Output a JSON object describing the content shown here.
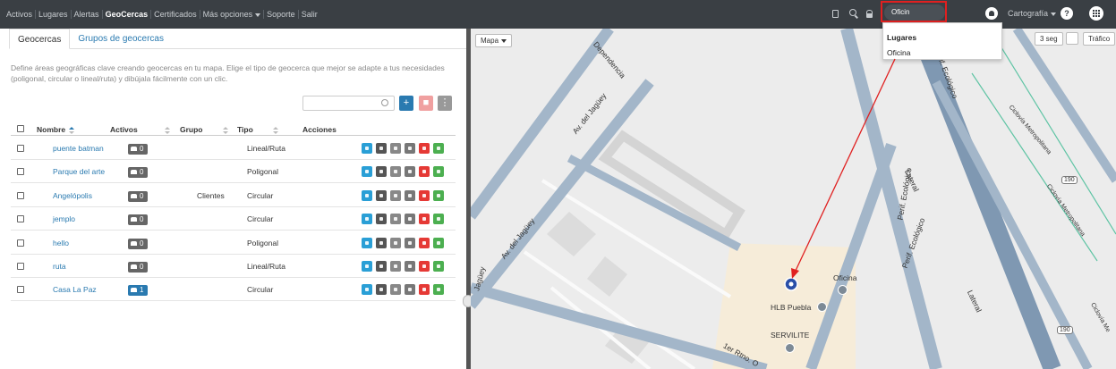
{
  "nav": {
    "items": [
      "Activos",
      "Lugares",
      "Alertas",
      "GeoCercas",
      "Certificados",
      "Más opciones",
      "Soporte",
      "Salir"
    ],
    "active": "GeoCercas"
  },
  "topbar": {
    "search_value": "Oficin",
    "cartography_label": "Cartografía",
    "help_label": "?"
  },
  "dropdown": {
    "header": "Lugares",
    "item": "Oficina"
  },
  "tabs": [
    "Geocercas",
    "Grupos de geocercas"
  ],
  "description": "Define áreas geográficas clave creando geocercas en tu mapa. Elige el tipo de geocerca que mejor se adapte a tus necesidades (poligonal, circular o lineal/ruta) y dibújala fácilmente con un clic.",
  "toolbar": {
    "search_placeholder": "",
    "add_label": "+",
    "delete_label": "■",
    "more_label": "⋮"
  },
  "table": {
    "headers": {
      "name": "Nombre",
      "assets": "Activos",
      "group": "Grupo",
      "type": "Tipo",
      "actions": "Acciones"
    },
    "rows": [
      {
        "name": "puente batman",
        "assets": "0",
        "group": "",
        "type": "Lineal/Ruta",
        "highlight": false
      },
      {
        "name": "Parque del arte",
        "assets": "0",
        "group": "",
        "type": "Poligonal",
        "highlight": false
      },
      {
        "name": "Angelópolis",
        "assets": "0",
        "group": "Clientes",
        "type": "Circular",
        "highlight": false
      },
      {
        "name": "jemplo",
        "assets": "0",
        "group": "",
        "type": "Circular",
        "highlight": false
      },
      {
        "name": "hello",
        "assets": "0",
        "group": "",
        "type": "Poligonal",
        "highlight": false
      },
      {
        "name": "ruta",
        "assets": "0",
        "group": "",
        "type": "Lineal/Ruta",
        "highlight": false
      },
      {
        "name": "Casa La Paz",
        "assets": "1",
        "group": "",
        "type": "Circular",
        "highlight": true
      }
    ]
  },
  "map": {
    "type_button": "Mapa",
    "refresh_button": "3 seg",
    "traffic_button": "Tráfico",
    "streets": {
      "dependencia": "Dependencia",
      "jaguey_1": "Av. del Jagüey",
      "jaguey_2": "Av. del Jagüey",
      "periferico_1": "Perif. Ecológico",
      "periferico_2": "Perif. Ecológico",
      "periferico_3": "Perif. Ecológico",
      "lateral_1": "Lateral",
      "lateral_2": "Lateral",
      "ciclovia_1": "Ciclovía Metropolitana",
      "ciclovia_2": "Ciclovía Metropolitana",
      "ciclovia_3": "Ciclovía Me",
      "highway_1": "190",
      "highway_2": "190",
      "rino": "1er Rtno. O",
      "jag_left": "Jagüey"
    },
    "places": {
      "oficina": "Oficina",
      "hlb": "HLB Puebla",
      "servilite": "SERVILITE"
    },
    "colors": {
      "road": "#a3b6c9",
      "highway": "#7f98b2",
      "plot": "#f6ecd9",
      "marker": "#2a4fa8",
      "annotation": "#e02020"
    }
  }
}
